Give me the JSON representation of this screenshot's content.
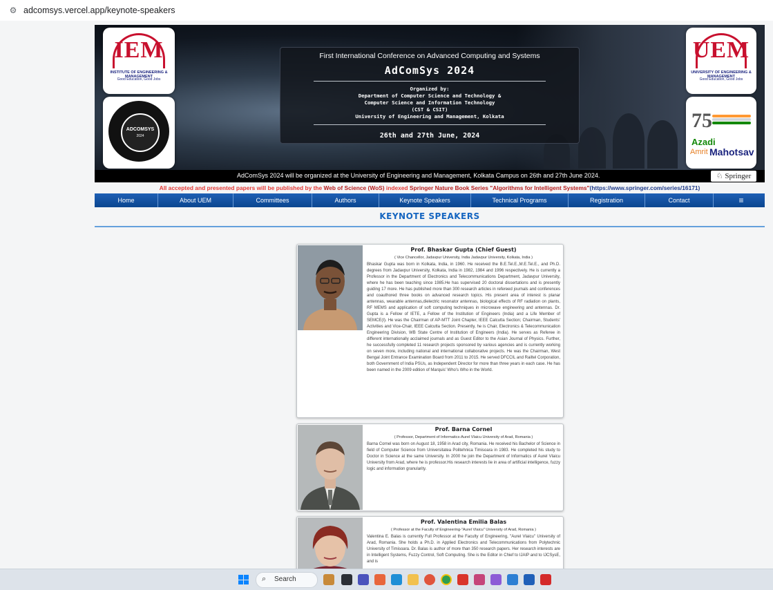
{
  "browser": {
    "url": "adcomsys.vercel.app/keynote-speakers"
  },
  "banner": {
    "iem_logo": {
      "letters": "IEM",
      "line1": "INSTITUTE OF ENGINEERING & MANAGEMENT",
      "line2": "Good Education, Good Jobs"
    },
    "uem_logo": {
      "letters": "UEM",
      "line1": "UNIVERSITY OF ENGINEERING & MANAGEMENT",
      "line2": "Good Education, Good Jobs"
    },
    "seal": {
      "text": "ADCOMSYS",
      "year": "2024"
    },
    "azadi": {
      "number": "75",
      "word1": "Azadi",
      "word2": "Amrit",
      "word3": "Mahotsav"
    },
    "subtitle": "First International Conference on Advanced Computing and Systems",
    "title": "AdComSys 2024",
    "organized_by": "Organized by:",
    "org_line1": "Department of Computer Science and Technology &",
    "org_line2": "Computer Science and Information Technology",
    "org_line3": "(CST & CSIT)",
    "org_line4": "University of Engineering and Management, Kolkata",
    "date": "26th and 27th June, 2024",
    "strip_text": "AdComSys 2024 will be organized at the University of Engineering and Management, Kolkata Campus on 26th and 27th June 2024.",
    "springer_label": "Springer"
  },
  "notice": {
    "part1": "All accepted and presented papers will be published by the ",
    "part2": "Web of Science (WoS)",
    "part3": " indexed ",
    "part4": "Springer Nature Book Series \"Algorithms for Intelligent Systems\"",
    "part5": "(https://www.springer.com/series/16171)"
  },
  "nav": {
    "items": [
      "Home",
      "About UEM",
      "Committees",
      "Authors",
      "Keynote Speakers",
      "Technical Programs",
      "Registration",
      "Contact"
    ],
    "menu_icon": "≡"
  },
  "section_title": "KEYNOTE SPEAKERS",
  "speakers": [
    {
      "name": "Prof. Bhaskar Gupta (Chief Guest)",
      "affiliation": "Vice Chancellor, Jadavpur University, India Jadavpur University, Kolkata, India",
      "bio": "Bhaskar Gupta was born in Kolkata, India, in 1960. He received the B.E.Tel.E.,M.E.Tel.E., and Ph.D. degrees from Jadavpur University, Kolkata, India in 1982, 1984 and 1996 respectively. He is currently a Professor in the Department of Electronics and Telecommunications Department, Jadavpur University, where he has been teaching since 1985.He has supervised 20 doctoral dissertations and is presently guiding 17 more. He has published more than 300 research articles in refereed journals and conferences and coauthored three books on advanced research topics. His present area of interest is planar antennas, wearable antennas,dielectric resonator antennas, biological effects of RF radiation on plants, RF MEMS and application of soft computing techniques in microwave engineering and antennas. Dr. Gupta is a Fellow of IETE, a Fellow of the Institution of Engineers (India) and a Life Member of SEMCE(I). He was the Chairman of AP-MTT Joint Chapter, IEEE Calcutta Section; Chairman, Students' Activities and Vice-Chair, IEEE Calcutta Section. Presently, he is Chair, Electronics & Telecommunication Engineering Division, WB State Centre of Institution of Engineers (India). He serves as Referee in different internationally acclaimed journals and as Guest Editor to the Asian Journal of Physics. Further, he successfully completed 11 research projects sponsored by various agencies and is currently working on seven more, including national and international collaborative projects. He was the Chairman, West Bengal Joint Entrance Examination Board from 2011 to 2015. He served DFCCIL and Railtel Corporation, both Government of India PSUs, as Independent Director for more than three years in each case. He has been named in the 2009 edition of Marquis' Who's Who in the World."
    },
    {
      "name": "Prof. Barna Cornel",
      "affiliation": "Professor, Department of Informatics-Aurel Vlaicu University of Arad, Romania",
      "bio": "Barna Cornel was born on August 18, 1958 in Arad city, Romania. He received his Bachelor of Science in field of Computer Science from Universitatea Politehnica Timisoara in 1983. He completed his study to Doctor in Science at the same University. In 2000 he join the Department of Informatics of Aurel Vlaicu University from Arad, where he is professor.His research interests lie in area of artificial intelligence, fuzzy logic and information granularity."
    },
    {
      "name": "Prof. Valentina Emilia Balas",
      "affiliation": "Professor at the Faculty of Engineering-\"Aurel Vlaicu\" University of Arad, Romania",
      "bio": "Valentina E. Balas is currently Full Professor at the Faculty of Engineering, \"Aurel Vlaicu\" University of Arad, Romania. She holds a Ph.D. in Applied Electronics and Telecommunications from Polytechnic University of Timisoara. Dr. Balas is author of more than 350 research papers. Her research interests are in Intelligent Systems, Fuzzy Control, Soft Computing. She is the Editor in Chief to IJAIP and to IJCSysE, and is"
    }
  ],
  "taskbar": {
    "search_label": "Search"
  },
  "colors": {
    "nav_blue": "#0b4690",
    "title_blue": "#1565c0",
    "notice_red": "#e53935"
  }
}
